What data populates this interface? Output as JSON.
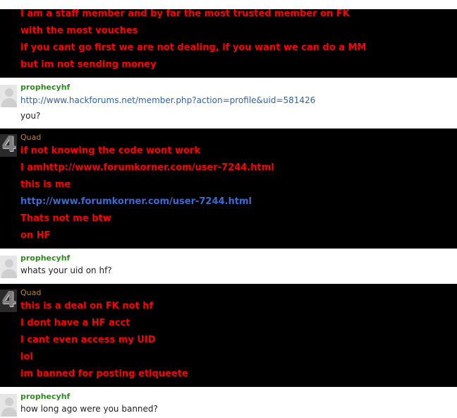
{
  "conversation": {
    "messages": [
      {
        "lines": [
          "I am a staff member and by far the most trusted member on FK",
          "with the most vouches",
          "if you cant go first we are not dealing, if you want we can do a MM",
          "but im not sending money"
        ]
      },
      {
        "author": "prophecyhf",
        "lines": [
          "http://www.hackforums.net/member.php?action=profile&uid=581426",
          "you?"
        ]
      },
      {
        "author": "Quad",
        "avatar_text": "4",
        "lines": [
          "if not knowing the code wont work",
          "I amhttp://www.forumkorner.com/user-7244.html",
          "this is me",
          "http://www.forumkorner.com/user-7244.html",
          "Thats not me btw",
          "on HF"
        ]
      },
      {
        "author": "prophecyhf",
        "lines": [
          "whats your uid on hf?"
        ]
      },
      {
        "author": "Quad",
        "avatar_text": "4",
        "lines": [
          "this is a deal on FK not hf",
          "I dont have a HF acct",
          "I cant even access my UID",
          "lol",
          "im banned for posting etiqueete"
        ]
      },
      {
        "author": "prophecyhf",
        "lines": [
          "how long ago were you banned?"
        ]
      }
    ]
  },
  "colors": {
    "dark_background": "#000000",
    "light_background": "#ffffff",
    "quad_text": "#ff0000",
    "quad_link": "#3c6bd3",
    "prophecy_name": "#2e8b1e",
    "quad_name": "#b8862a",
    "prophecy_link": "#2a63b0",
    "prophecy_text": "#222222"
  },
  "icons": {
    "default_avatar": "default-avatar-icon",
    "quad_avatar": "quad-avatar-icon"
  }
}
